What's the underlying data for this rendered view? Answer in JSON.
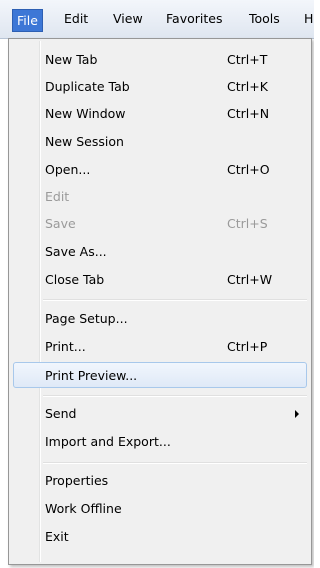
{
  "menubar": {
    "file": "File",
    "edit": "Edit",
    "view": "View",
    "favorites": "Favorites",
    "tools": "Tools",
    "help_partial": "H"
  },
  "file_menu": {
    "new_tab": {
      "label": "New Tab",
      "shortcut": "Ctrl+T"
    },
    "duplicate_tab": {
      "label": "Duplicate Tab",
      "shortcut": "Ctrl+K"
    },
    "new_window": {
      "label": "New Window",
      "shortcut": "Ctrl+N"
    },
    "new_session": {
      "label": "New Session"
    },
    "open": {
      "label": "Open...",
      "shortcut": "Ctrl+O"
    },
    "edit": {
      "label": "Edit"
    },
    "save": {
      "label": "Save",
      "shortcut": "Ctrl+S"
    },
    "save_as": {
      "label": "Save As..."
    },
    "close_tab": {
      "label": "Close Tab",
      "shortcut": "Ctrl+W"
    },
    "page_setup": {
      "label": "Page Setup..."
    },
    "print": {
      "label": "Print...",
      "shortcut": "Ctrl+P"
    },
    "print_preview": {
      "label": "Print Preview..."
    },
    "send": {
      "label": "Send"
    },
    "import_export": {
      "label": "Import and Export..."
    },
    "properties": {
      "label": "Properties"
    },
    "work_offline": {
      "label": "Work Offline"
    },
    "exit": {
      "label": "Exit"
    }
  },
  "colors": {
    "active_menu": "#3d77d6",
    "hover_border": "#a8c8eb",
    "disabled_text": "#9a9a9a"
  }
}
